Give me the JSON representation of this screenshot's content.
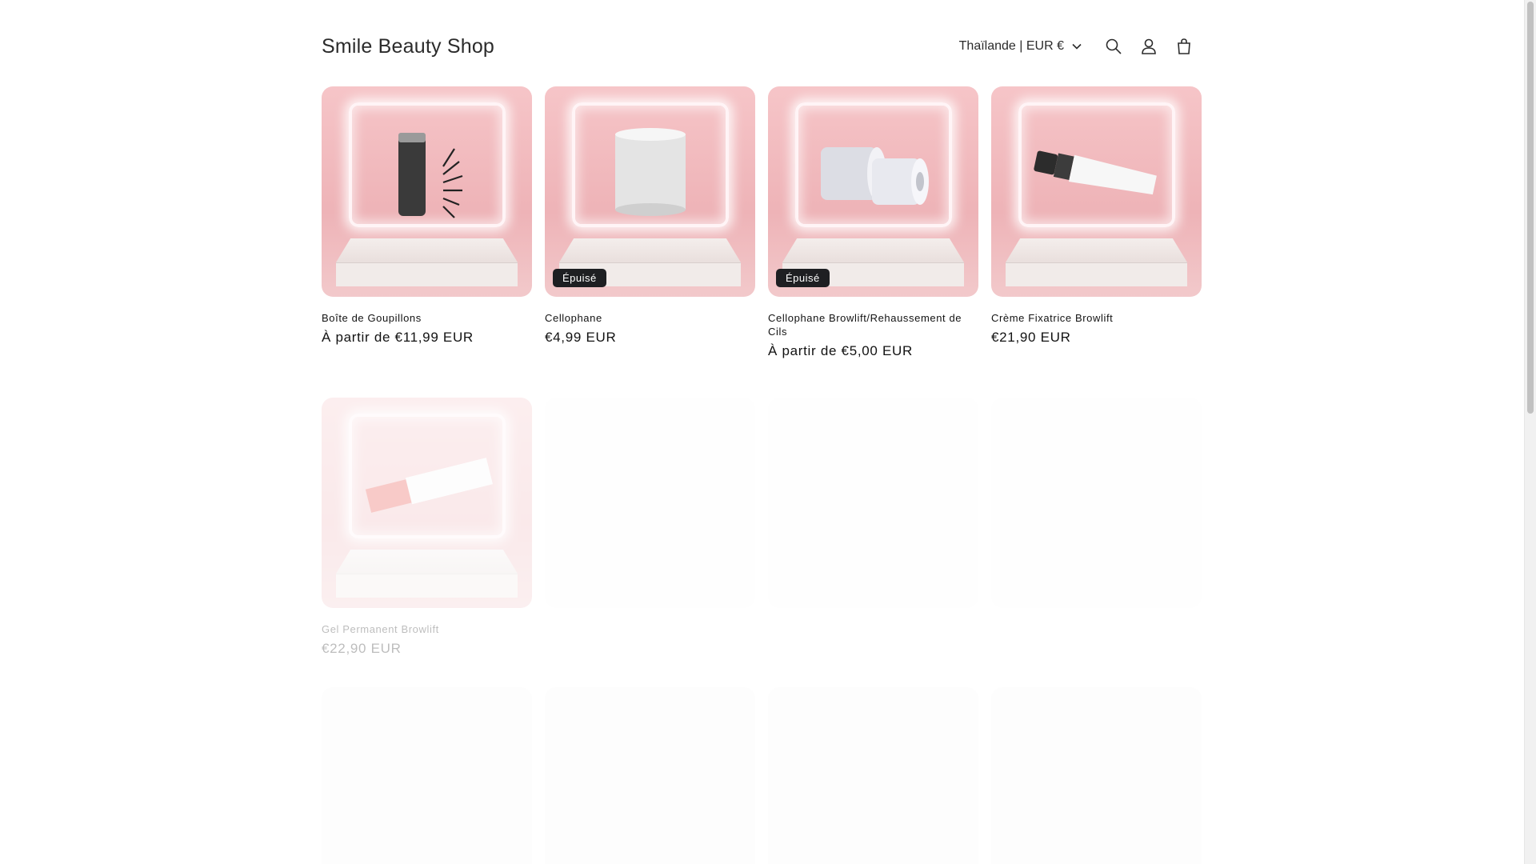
{
  "header": {
    "logo": "Smile Beauty Shop",
    "locale": "Thaïlande | EUR €"
  },
  "products_row1": [
    {
      "title": "Boîte de Goupillons",
      "price": "À partir de €11,99 EUR",
      "badge": ""
    },
    {
      "title": "Cellophane",
      "price": "€4,99 EUR",
      "badge": "Épuisé"
    },
    {
      "title": "Cellophane Browlift/Rehaussement de Cils",
      "price": "À partir de €5,00 EUR",
      "badge": "Épuisé"
    },
    {
      "title": "Crème Fixatrice Browlift",
      "price": "€21,90 EUR",
      "badge": ""
    }
  ],
  "products_row2": [
    {
      "title": "Gel Permanent Browlift",
      "price": "€22,90 EUR"
    }
  ]
}
